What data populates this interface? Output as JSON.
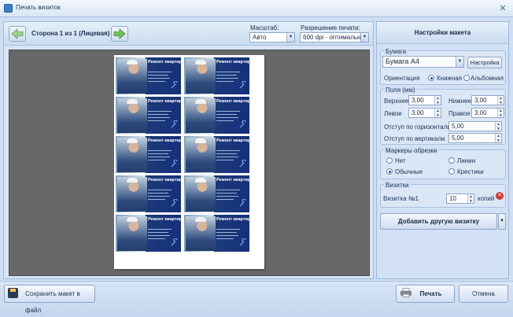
{
  "window": {
    "title": "Печать визиток"
  },
  "toolbar": {
    "page_label": "Сторона 1 из 1 (Лицевая)",
    "scale_label": "Масштаб:",
    "scale_value": "Авто",
    "resolution_label": "Разрешение печати:",
    "resolution_value": "600 dpi - оптимальное"
  },
  "preview": {
    "card_title": "Ремонт квартир",
    "rows": 5,
    "cols": 2
  },
  "settings": {
    "header": "Настройки макета",
    "paper": {
      "group_title": "Бумага",
      "paper_value": "Бумага А4",
      "setup_button": "Настройка",
      "orientation_label": "Ориентация",
      "portrait": "Книжная",
      "landscape": "Альбомная",
      "selected": "portrait"
    },
    "margins": {
      "group_title": "Поля (мм)",
      "top_label": "Верхнее",
      "top": "3,00",
      "bottom_label": "Нижнее",
      "bottom": "3,00",
      "left_label": "Левое",
      "left": "3,00",
      "right_label": "Правое",
      "right": "3,00",
      "hgap_label": "Отступ по горизонтали",
      "hgap": "5,00",
      "vgap_label": "Отступ по вертикали",
      "vgap": "5,00"
    },
    "markers": {
      "group_title": "Маркеры обрезки",
      "none": "Нет",
      "lines": "Линии",
      "normal": "Обычные",
      "crosses": "Крестики",
      "selected": "normal"
    },
    "cards": {
      "group_title": "Визитки",
      "card_name": "Визитка №1",
      "count": "10",
      "copies_label": "копий"
    },
    "add_button": "Добавить другую визитку"
  },
  "footer": {
    "save_label": "Сохранить макет в файл",
    "print_label": "Печать",
    "cancel_label": "Отмена"
  },
  "colors": {
    "card_blue": "#16307a",
    "panel_bg": "#d2e1f4",
    "preview_bg": "#686868"
  }
}
